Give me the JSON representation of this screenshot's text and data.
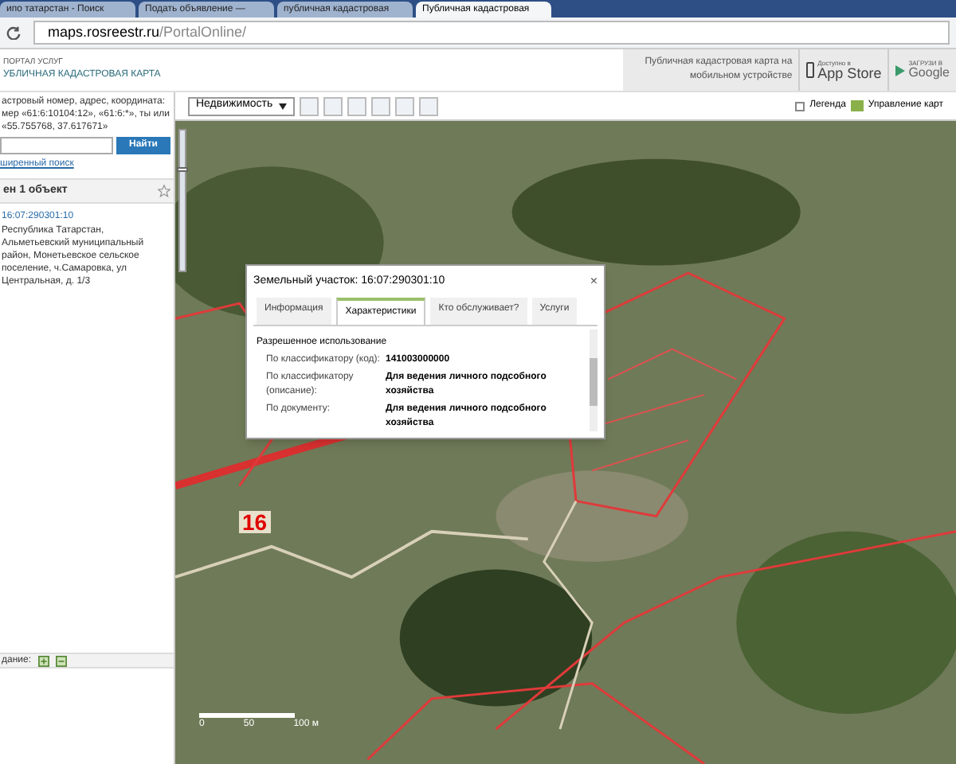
{
  "browser": {
    "tabs": [
      {
        "label": "ипо татарстан - Поиск",
        "selected": false
      },
      {
        "label": "Подать объявление — ",
        "selected": false
      },
      {
        "label": "публичная кадастровая",
        "selected": false
      },
      {
        "label": "Публичная кадастровая",
        "selected": true
      }
    ],
    "address": {
      "host": "maps.rosreestr.ru",
      "path": "/PortalOnline/"
    }
  },
  "header": {
    "portal": "ПОРТАЛ УСЛУГ",
    "title": "УБЛИЧНАЯ КАДАСТРОВАЯ КАРТА",
    "mobile": "Публичная кадастровая карта на мобильном устройстве",
    "appstore_small": "Доступно в",
    "appstore": "App Store",
    "google_small": "ЗАГРУЗИ В",
    "google": "Google"
  },
  "sidebar": {
    "hint": "астровый номер, адрес, координата: мер «61:6:10104:12», «61:6:*», ты или «55.755768, 37.617671»",
    "search_button": "Найти",
    "advanced_link": "ширенный поиск",
    "results_title": "ен 1 объект",
    "results": [
      {
        "number": "16:07:290301:10",
        "address": "Республика Татарстан, Альметьевский муниципальный район, Монетьевское сельское поселение, ч.Самаровка, ул Центральная, д. 1/3",
        "selected": true
      }
    ],
    "footer": "дание:"
  },
  "toolbar": {
    "layer": "Недвижимость",
    "legend": "Легенда",
    "legend_checked": false,
    "manage": "Управление карт"
  },
  "map": {
    "zoom": {
      "level": 0.7
    },
    "labels": [
      "16"
    ],
    "scale": [
      "0",
      "50",
      "100 м"
    ]
  },
  "popup": {
    "title": "Земельный участок: 16:07:290301:10",
    "close": "×",
    "tabs": [
      {
        "label": "Информация",
        "selected": false
      },
      {
        "label": "Характеристики",
        "selected": true
      },
      {
        "label": "Кто обслуживает?",
        "selected": false
      },
      {
        "label": "Услуги",
        "selected": false
      }
    ],
    "section": "Разрешенное использование",
    "rows": [
      {
        "label": "По классификатору (код):",
        "value": "141003000000"
      },
      {
        "label": "По классификатору (описание):",
        "value": "Для ведения личного подсобного хозяйства"
      },
      {
        "label": "По документу:",
        "value": "Для ведения личного подсобного хозяйства"
      }
    ]
  }
}
